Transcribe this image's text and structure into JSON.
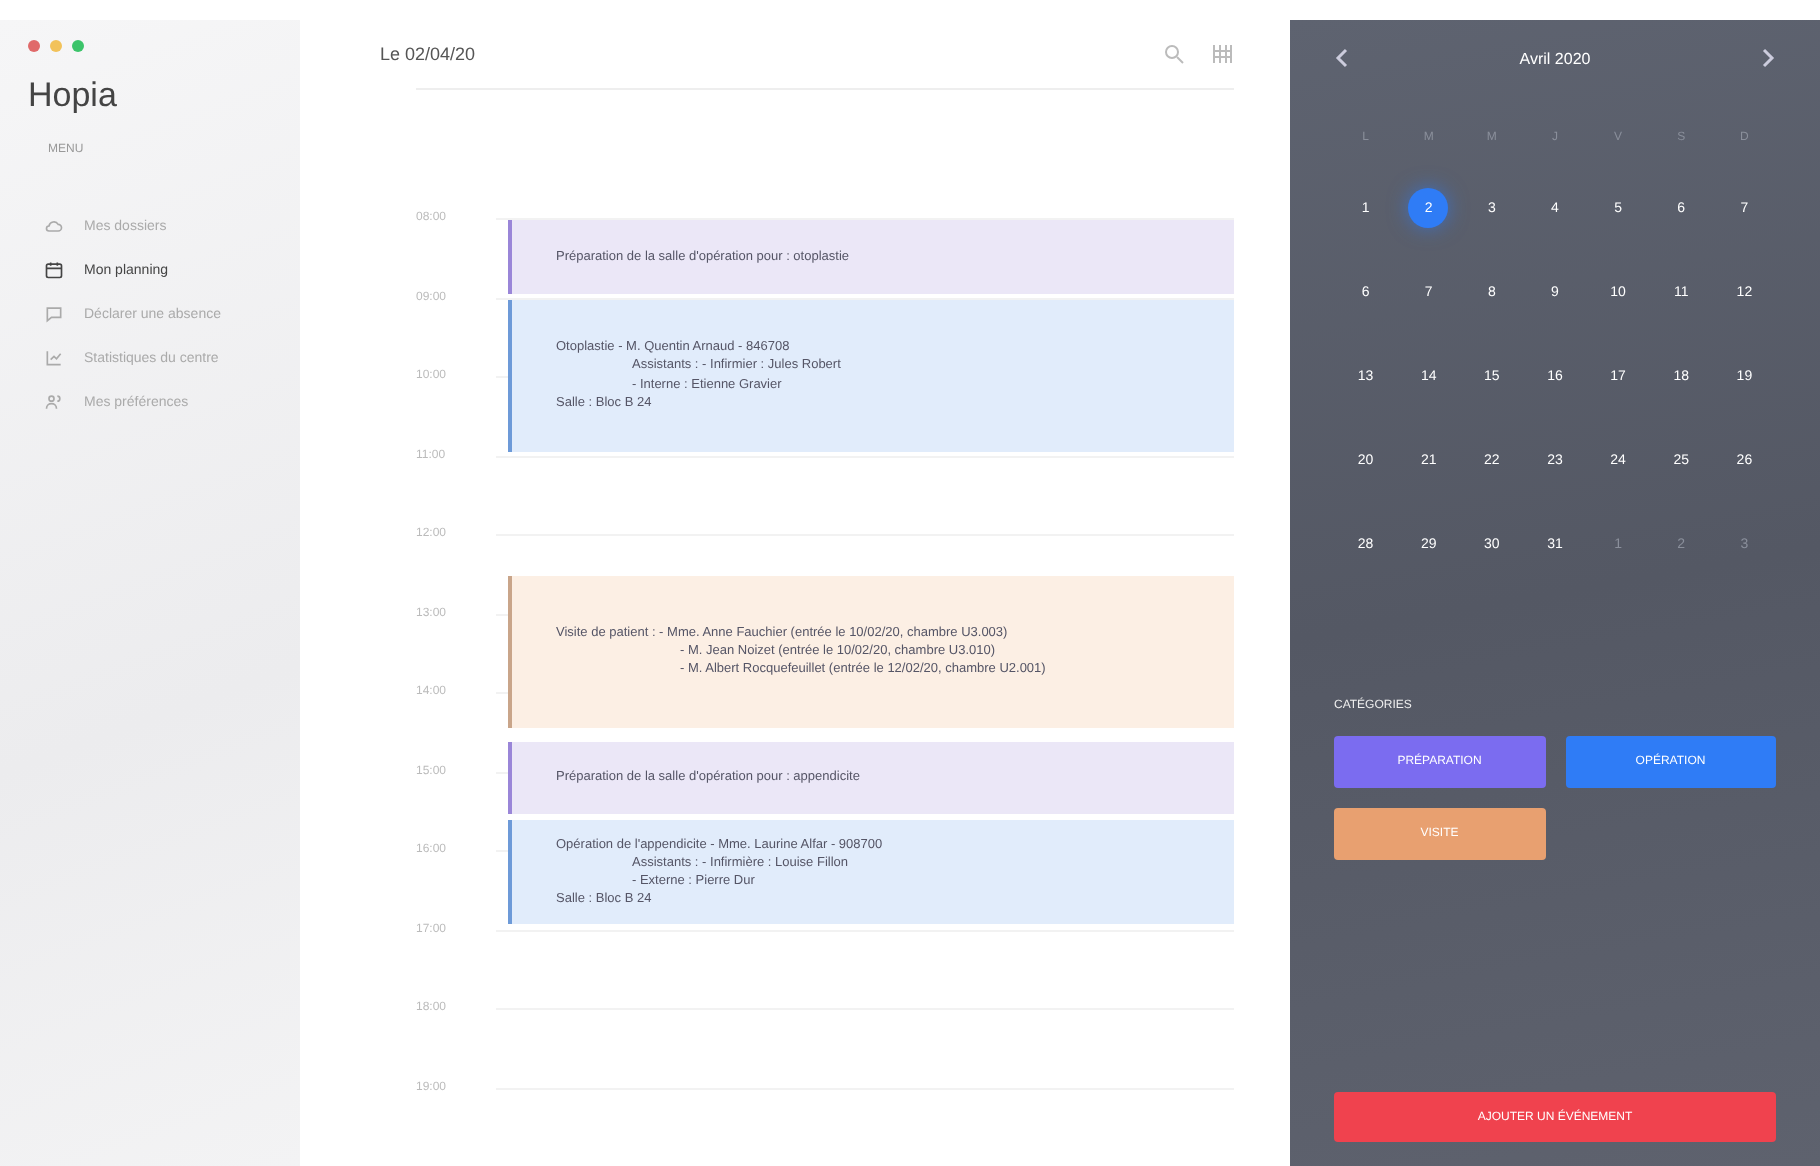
{
  "window": {
    "controls": [
      {
        "color": "#e06a6a"
      },
      {
        "color": "#f2c25a"
      },
      {
        "color": "#3cc46a"
      }
    ]
  },
  "sidebar": {
    "app_name": "Hopia",
    "section": "MENU",
    "items": [
      {
        "label": "Mes dossiers",
        "selected": false
      },
      {
        "label": "Mon planning",
        "selected": true
      },
      {
        "label": "Déclarer une absence",
        "selected": false
      },
      {
        "label": "Statistiques du centre",
        "selected": false
      },
      {
        "label": "Mes préférences",
        "selected": false
      }
    ]
  },
  "planning": {
    "date": "Le 02/04/20",
    "hours": [
      "08:00",
      "09:00",
      "10:00",
      "11:00",
      "12:00",
      "13:00",
      "14:00",
      "15:00",
      "16:00",
      "17:00",
      "18:00",
      "19:00"
    ],
    "events": [
      {
        "kind": "preparation",
        "lines": [
          "Préparation de la salle d'opération pour : otoplastie"
        ]
      },
      {
        "kind": "operation",
        "lines": [
          "Otoplastie - M. Quentin Arnaud - 846708",
          "Assistants : - Infirmier : Jules Robert",
          "- Interne : Etienne Gravier",
          "Salle : Bloc B 24"
        ]
      },
      {
        "kind": "visit",
        "lines": [
          "Visite de patient : - Mme. Anne Fauchier (entrée le 10/02/20, chambre U3.003)",
          "- M. Jean Noizet (entrée le 10/02/20, chambre U3.010)",
          "- M. Albert Rocquefeuillet (entrée le 12/02/20, chambre U2.001)"
        ]
      },
      {
        "kind": "preparation",
        "lines": [
          "Préparation de la salle d'opération pour : appendicite"
        ]
      },
      {
        "kind": "operation",
        "lines": [
          "Opération de l'appendicite - Mme. Laurine Alfar - 908700",
          "Assistants : - Infirmière : Louise Fillon",
          "- Externe : Pierre Dur",
          "Salle : Bloc B 24"
        ]
      }
    ]
  },
  "calendar": {
    "month": "Avril 2020",
    "weekdays": [
      "L",
      "M",
      "M",
      "J",
      "V",
      "S",
      "D"
    ],
    "days": [
      {
        "label": "1",
        "selected": false,
        "muted": false
      },
      {
        "label": "2",
        "selected": true,
        "muted": false
      },
      {
        "label": "3",
        "selected": false,
        "muted": false
      },
      {
        "label": "4",
        "selected": false,
        "muted": false
      },
      {
        "label": "5",
        "selected": false,
        "muted": false
      },
      {
        "label": "6",
        "selected": false,
        "muted": false
      },
      {
        "label": "7",
        "selected": false,
        "muted": false
      },
      {
        "label": "6",
        "selected": false,
        "muted": false
      },
      {
        "label": "7",
        "selected": false,
        "muted": false
      },
      {
        "label": "8",
        "selected": false,
        "muted": false
      },
      {
        "label": "9",
        "selected": false,
        "muted": false
      },
      {
        "label": "10",
        "selected": false,
        "muted": false
      },
      {
        "label": "11",
        "selected": false,
        "muted": false
      },
      {
        "label": "12",
        "selected": false,
        "muted": false
      },
      {
        "label": "13",
        "selected": false,
        "muted": false
      },
      {
        "label": "14",
        "selected": false,
        "muted": false
      },
      {
        "label": "15",
        "selected": false,
        "muted": false
      },
      {
        "label": "16",
        "selected": false,
        "muted": false
      },
      {
        "label": "17",
        "selected": false,
        "muted": false
      },
      {
        "label": "18",
        "selected": false,
        "muted": false
      },
      {
        "label": "19",
        "selected": false,
        "muted": false
      },
      {
        "label": "20",
        "selected": false,
        "muted": false
      },
      {
        "label": "21",
        "selected": false,
        "muted": false
      },
      {
        "label": "22",
        "selected": false,
        "muted": false
      },
      {
        "label": "23",
        "selected": false,
        "muted": false
      },
      {
        "label": "24",
        "selected": false,
        "muted": false
      },
      {
        "label": "25",
        "selected": false,
        "muted": false
      },
      {
        "label": "26",
        "selected": false,
        "muted": false
      },
      {
        "label": "28",
        "selected": false,
        "muted": false
      },
      {
        "label": "29",
        "selected": false,
        "muted": false
      },
      {
        "label": "30",
        "selected": false,
        "muted": false
      },
      {
        "label": "31",
        "selected": false,
        "muted": false
      },
      {
        "label": "1",
        "selected": false,
        "muted": true
      },
      {
        "label": "2",
        "selected": false,
        "muted": true
      },
      {
        "label": "3",
        "selected": false,
        "muted": true
      }
    ]
  },
  "categories": {
    "title": "CATÉGORIES",
    "items": [
      {
        "label": "PRÉPARATION",
        "color": "#7b6cf0"
      },
      {
        "label": "OPÉRATION",
        "color": "#2f7cf6"
      },
      {
        "label": "VISITE",
        "color": "#e8a070"
      }
    ]
  },
  "action_button": "AJOUTER UN ÉVÉNEMENT"
}
